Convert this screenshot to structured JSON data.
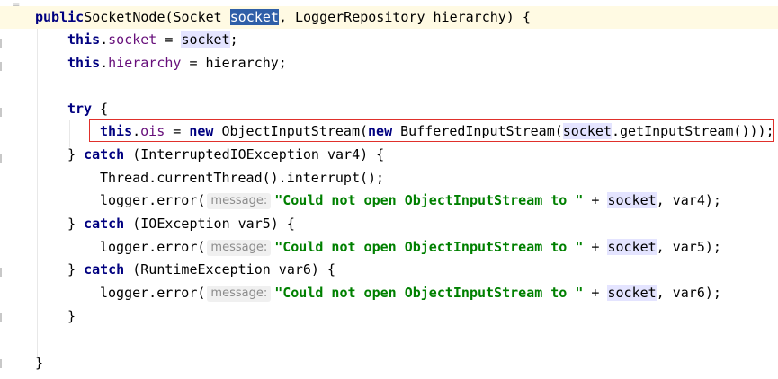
{
  "editor": {
    "fold_marker": "=",
    "lines": [
      {
        "id": "l1",
        "parts": [
          [
            "kw",
            "public"
          ],
          [
            "",
            "SocketNode(Socket "
          ],
          [
            "sel",
            "socket"
          ],
          [
            "",
            ", LoggerRepository hierarchy) {"
          ]
        ]
      },
      {
        "id": "l2",
        "parts": [
          [
            "kw",
            "this"
          ],
          [
            "",
            "."
          ],
          [
            "field",
            "socket"
          ],
          [
            "",
            " = "
          ],
          [
            "hl",
            "socket"
          ],
          [
            "",
            ";"
          ]
        ]
      },
      {
        "id": "l3",
        "parts": [
          [
            "kw",
            "this"
          ],
          [
            "",
            "."
          ],
          [
            "field",
            "hierarchy"
          ],
          [
            "",
            " = hierarchy;"
          ]
        ]
      },
      {
        "id": "l4",
        "parts": []
      },
      {
        "id": "l5",
        "parts": [
          [
            "kw",
            "try"
          ],
          [
            "",
            " {"
          ]
        ]
      },
      {
        "id": "l6",
        "parts": [
          [
            "kw",
            "this"
          ],
          [
            "",
            "."
          ],
          [
            "field",
            "ois"
          ],
          [
            "",
            " = "
          ],
          [
            "kw",
            "new"
          ],
          [
            "",
            " ObjectInputStream("
          ],
          [
            "kw",
            "new"
          ],
          [
            "",
            " BufferedInputStream("
          ],
          [
            "hl",
            "socket"
          ],
          [
            "",
            ".getInputStream()));"
          ]
        ]
      },
      {
        "id": "l7",
        "parts": [
          [
            "",
            "} "
          ],
          [
            "kw",
            "catch"
          ],
          [
            "",
            " (InterruptedIOException var4) {"
          ]
        ]
      },
      {
        "id": "l8",
        "parts": [
          [
            "",
            "Thread.currentThread().interrupt();"
          ]
        ]
      },
      {
        "id": "l9",
        "parts": [
          [
            "",
            "logger.error("
          ],
          [
            "hint",
            "message:"
          ],
          [
            "str",
            "\"Could not open ObjectInputStream to \""
          ],
          [
            "",
            " + "
          ],
          [
            "hl",
            "socket"
          ],
          [
            "",
            ", var4);"
          ]
        ]
      },
      {
        "id": "l10",
        "parts": [
          [
            "",
            "} "
          ],
          [
            "kw",
            "catch"
          ],
          [
            "",
            " (IOException var5) {"
          ]
        ]
      },
      {
        "id": "l11",
        "parts": [
          [
            "",
            "logger.error("
          ],
          [
            "hint",
            "message:"
          ],
          [
            "str",
            "\"Could not open ObjectInputStream to \""
          ],
          [
            "",
            " + "
          ],
          [
            "hl",
            "socket"
          ],
          [
            "",
            ", var5);"
          ]
        ]
      },
      {
        "id": "l12",
        "parts": [
          [
            "",
            "} "
          ],
          [
            "kw",
            "catch"
          ],
          [
            "",
            " (RuntimeException var6) {"
          ]
        ]
      },
      {
        "id": "l13",
        "parts": [
          [
            "",
            "logger.error("
          ],
          [
            "hint",
            "message:"
          ],
          [
            "str",
            "\"Could not open ObjectInputStream to \""
          ],
          [
            "",
            " + "
          ],
          [
            "hl",
            "socket"
          ],
          [
            "",
            ", var6);"
          ]
        ]
      },
      {
        "id": "l14",
        "parts": [
          [
            "",
            "}"
          ]
        ]
      },
      {
        "id": "l15",
        "parts": []
      },
      {
        "id": "l16",
        "parts": [
          [
            "",
            "}"
          ]
        ]
      }
    ]
  },
  "colors": {
    "keyword": "#000080",
    "field": "#660e7a",
    "string": "#008000",
    "selection": "#2f5fa8",
    "usage_highlight": "#e4e4ff",
    "current_line": "#fffae3",
    "annotation_box": "#e0302b"
  }
}
